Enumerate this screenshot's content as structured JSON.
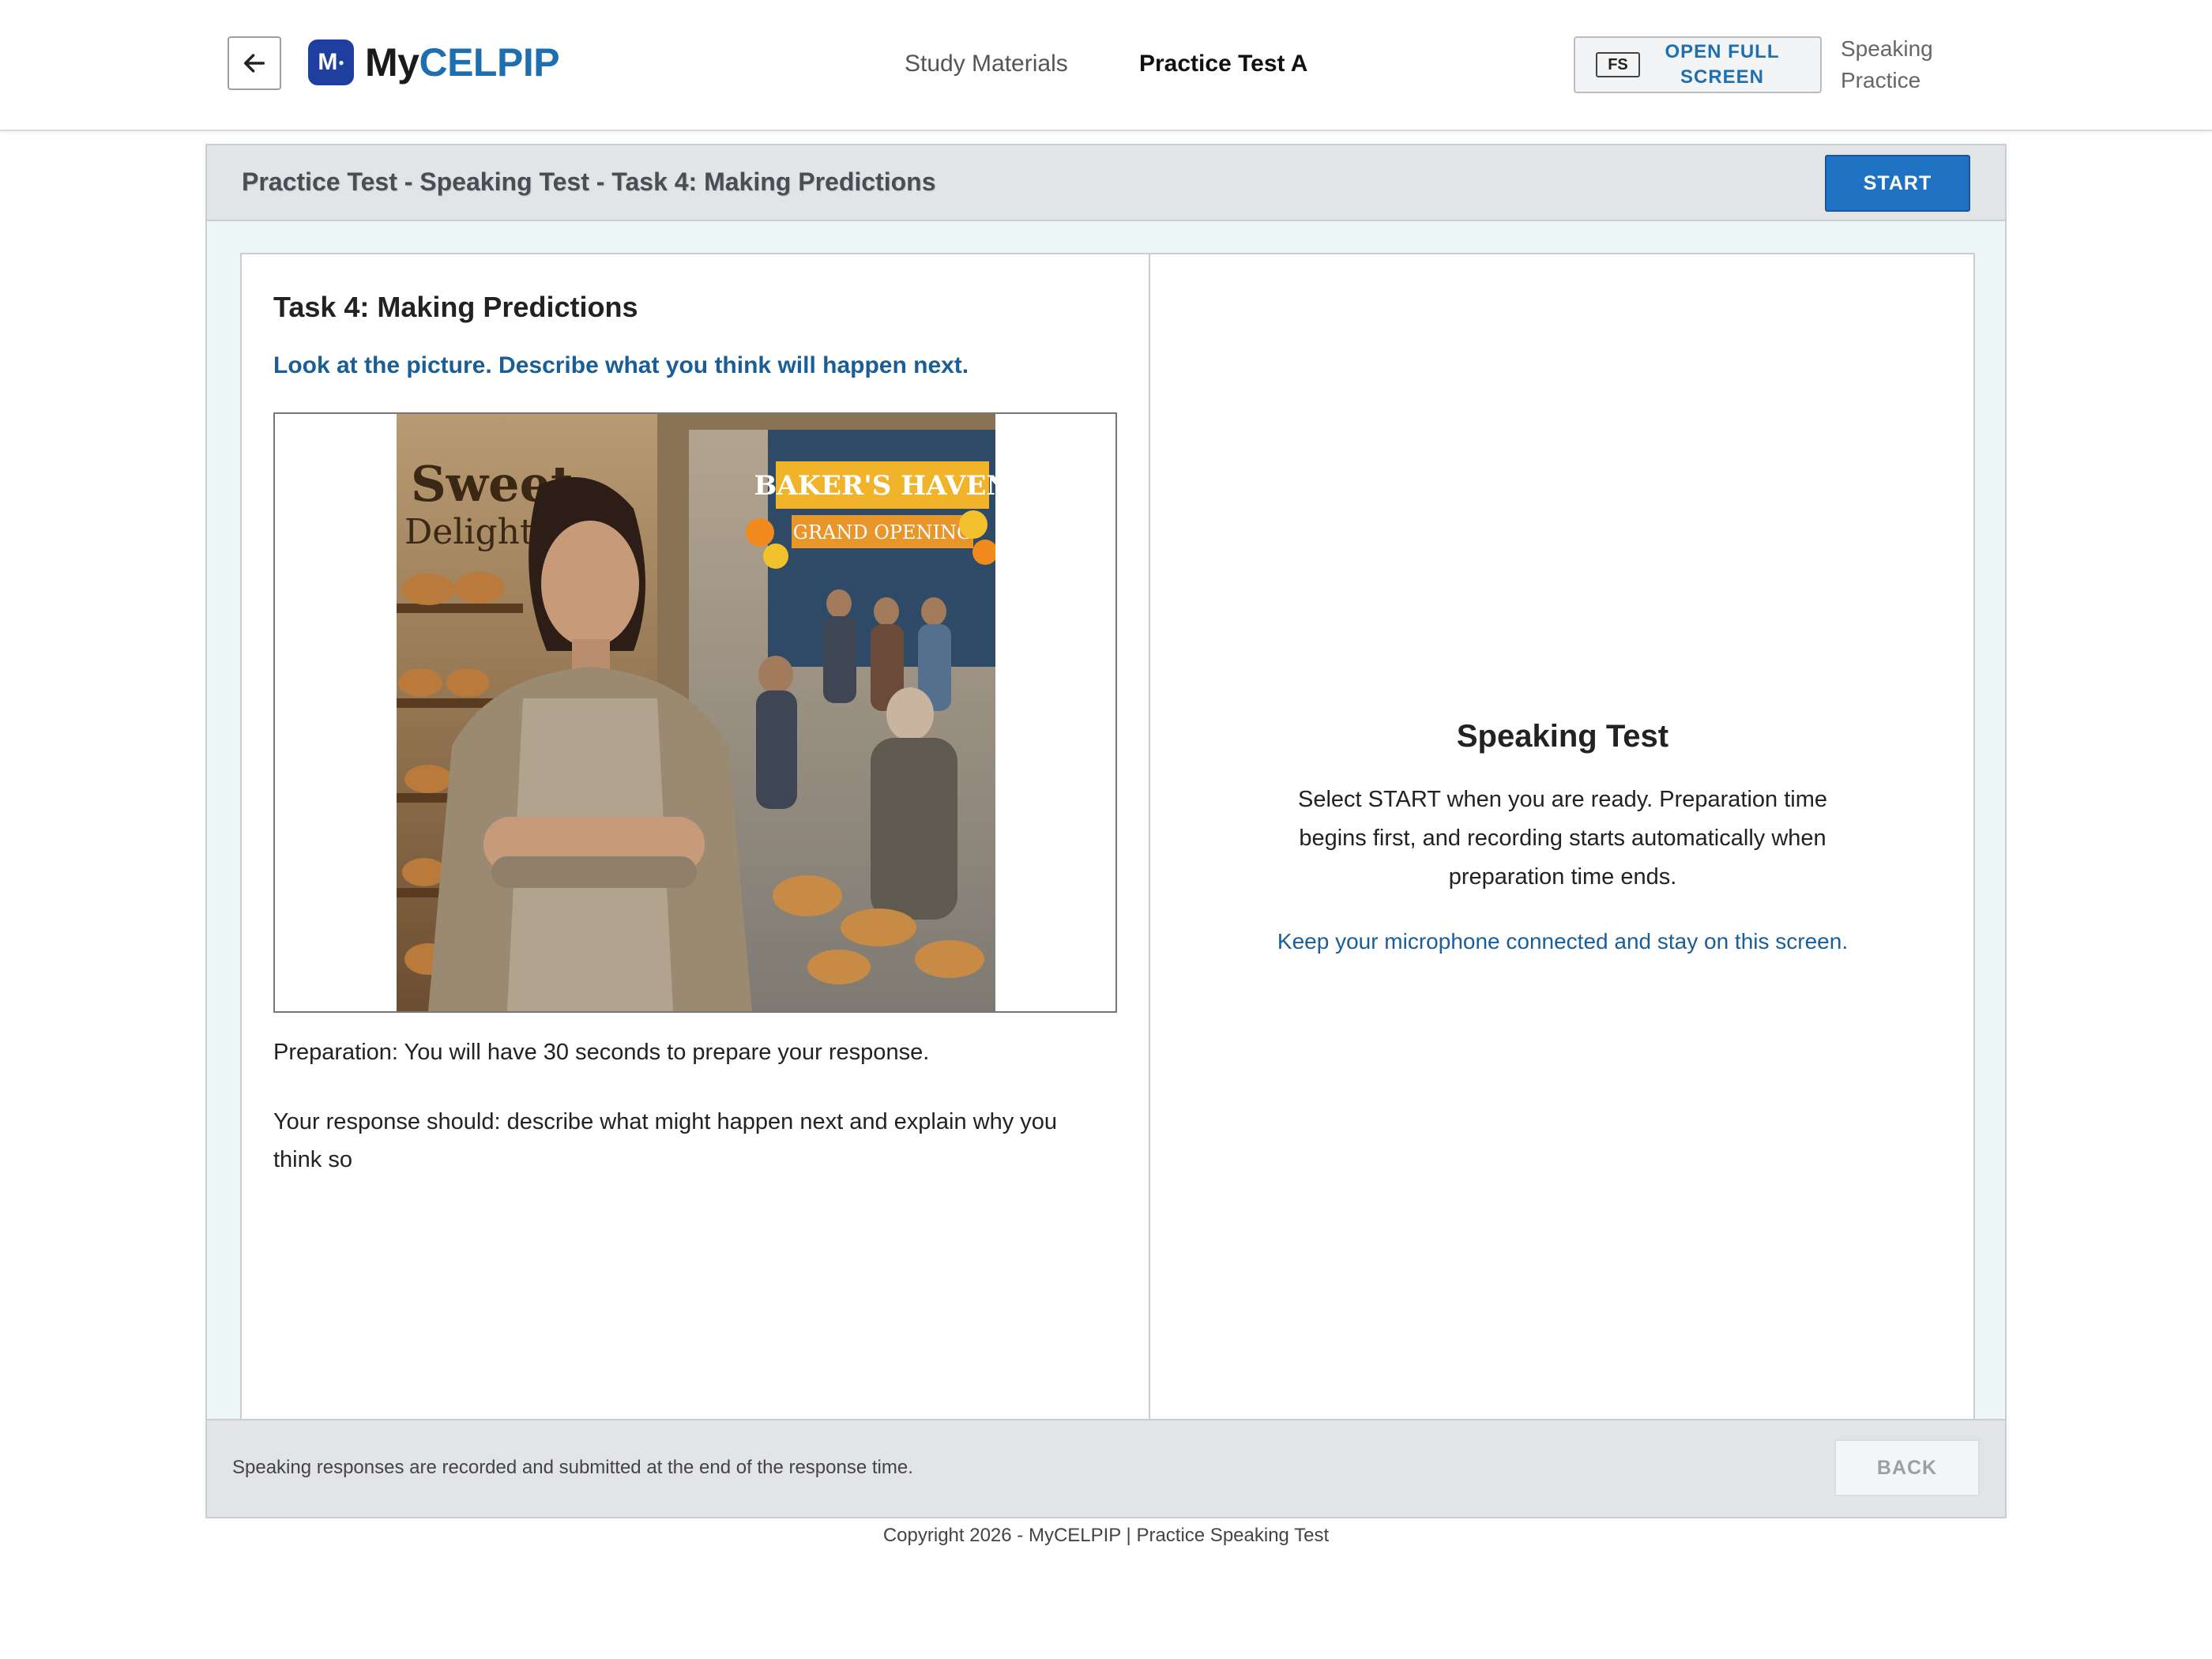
{
  "header": {
    "logo_badge": "M",
    "logo_my": "My",
    "logo_celpip": "CELPIP",
    "nav": {
      "study_materials": "Study Materials",
      "practice_test": "Practice Test A"
    },
    "fullscreen": {
      "tag": "FS",
      "label_line1": "OPEN FULL",
      "label_line2": "SCREEN"
    },
    "mode_line1": "Speaking",
    "mode_line2": "Practice",
    "back_icon": "arrow-left-icon"
  },
  "panel": {
    "title": "Practice Test - Speaking Test - Task 4: Making Predictions",
    "start_label": "START"
  },
  "task": {
    "title": "Task 4: Making Predictions",
    "instruction": "Look at the picture. Describe what you think will happen next.",
    "picture_signs": {
      "shop_sign_line1": "Sweet",
      "shop_sign_line2": "Delights",
      "rival_sign": "BAKER'S HAVEN",
      "rival_banner": "GRAND OPENING"
    },
    "preparation": "Preparation: You will have 30 seconds to prepare your response.",
    "response": "Your response should: describe what might happen next and explain why you think so"
  },
  "speaking": {
    "title": "Speaking Test",
    "description": "Select START when you are ready. Preparation time begins first, and recording starts automatically when preparation time ends.",
    "note": "Keep your microphone connected and stay on this screen."
  },
  "footer": {
    "note": "Speaking responses are recorded and submitted at the end of the response time.",
    "back_label": "BACK"
  },
  "copyright": "Copyright 2026 - MyCELPIP | Practice Speaking Test",
  "colors": {
    "brand_blue": "#1d6fb0",
    "start_button": "#1f72c1",
    "instruction_blue": "#1a5e98",
    "panel_bg": "#eef7f8"
  }
}
